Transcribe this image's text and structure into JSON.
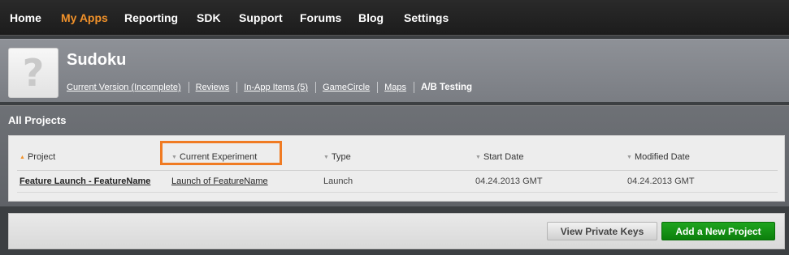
{
  "topnav": {
    "items": [
      {
        "label": "Home"
      },
      {
        "label": "My Apps"
      },
      {
        "label": "Reporting"
      },
      {
        "label": "SDK"
      },
      {
        "label": "Support"
      },
      {
        "label": "Forums"
      },
      {
        "label": "Blog"
      },
      {
        "label": "Settings"
      }
    ],
    "active": "My Apps",
    "active_color": "#f2922a"
  },
  "app": {
    "icon": "question-mark-icon",
    "icon_glyph": "?",
    "title": "Sudoku",
    "subnav": [
      {
        "label": "Current Version (Incomplete)"
      },
      {
        "label": "Reviews"
      },
      {
        "label": "In-App Items (5)"
      },
      {
        "label": "GameCircle"
      },
      {
        "label": "Maps"
      },
      {
        "label": "A/B Testing"
      }
    ],
    "current_subnav": "A/B Testing"
  },
  "projects": {
    "section_title": "All Projects",
    "columns": [
      "Project",
      "Current Experiment",
      "Type",
      "Start Date",
      "Modified Date"
    ],
    "sorted_column": "Project",
    "rows": [
      {
        "project": "Feature Launch - FeatureName",
        "experiment": "Launch of FeatureName",
        "type": "Launch",
        "start_date": "04.24.2013 GMT",
        "modified_date": "04.24.2013 GMT"
      }
    ],
    "highlight_color": "#f07b23"
  },
  "actions": {
    "view_keys_label": "View Private Keys",
    "add_project_label": "Add a New Project",
    "add_project_color": "#128f12"
  }
}
